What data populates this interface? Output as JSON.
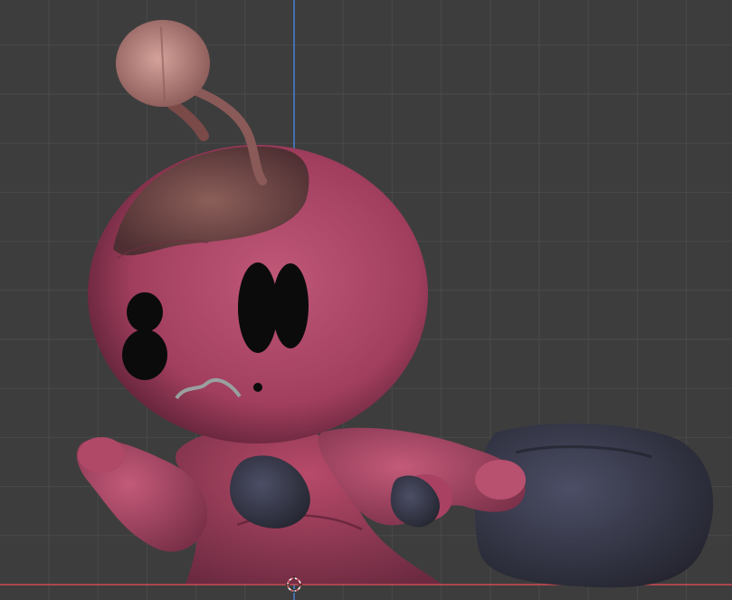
{
  "viewport": {
    "view": "front-orthographic",
    "background_color": "#3d3d3d",
    "grid_line_color": "#4a4a4a",
    "z_axis_color": "#4a7fd0",
    "x_axis_color": "#d04a55",
    "grid_visible": true
  },
  "model": {
    "subject": "pink-robot-character",
    "body_color": "#b84a6a",
    "shadow_color": "#6b2a40",
    "rust_color": "#7a5a55",
    "rock_color": "#3d3f55",
    "disc_color": "#c8908a"
  },
  "cursor": {
    "icon": "3d-cursor-icon"
  }
}
